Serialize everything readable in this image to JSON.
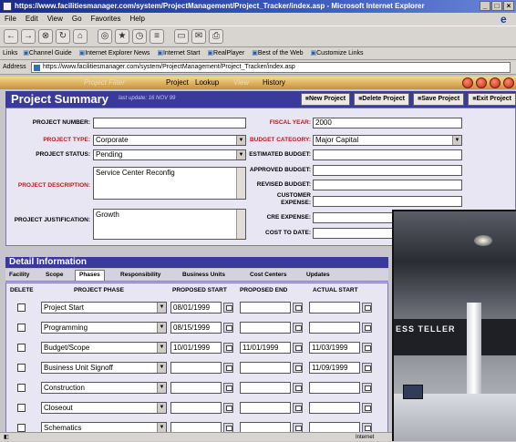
{
  "window": {
    "title": "https://www.facilitiesmanager.com/system/ProjectManagement/Project_Tracker/index.asp - Microsoft Internet Explorer"
  },
  "menubar": [
    "File",
    "Edit",
    "View",
    "Go",
    "Favorites",
    "Help"
  ],
  "toolbar_icons": [
    "back-icon",
    "forward-icon",
    "stop-icon",
    "refresh-icon",
    "home-icon",
    "search-icon",
    "favorites-icon",
    "history-icon",
    "channels-icon",
    "fullscreen-icon",
    "mail-icon",
    "print-icon"
  ],
  "links": {
    "label": "Links",
    "items": [
      "Channel Guide",
      "Internet Explorer News",
      "Internet Start",
      "RealPlayer",
      "Best of the Web",
      "Customize Links"
    ]
  },
  "address": {
    "label": "Address",
    "url": "https://www.facilitiesmanager.com/system/ProjectManagement/Project_Tracker/index.asp"
  },
  "appnav": {
    "filter": "Project Filter",
    "items": [
      "Project",
      "Lookup",
      "View",
      "History"
    ]
  },
  "summary": {
    "title": "Project Summary",
    "last_update": "last update: 16 NOV 99",
    "buttons": [
      "New Project",
      "Delete Project",
      "Save Project",
      "Exit Project"
    ]
  },
  "form": {
    "project_number": {
      "label": "PROJECT NUMBER:",
      "value": ""
    },
    "project_type": {
      "label": "PROJECT TYPE:",
      "value": "Corporate"
    },
    "project_status": {
      "label": "PROJECT STATUS:",
      "value": "Pending"
    },
    "project_description": {
      "label": "PROJECT DESCRIPTION:",
      "value": "Service Center Reconfig"
    },
    "project_justification": {
      "label": "PROJECT JUSTIFICATION:",
      "value": "Growth"
    },
    "fiscal_year": {
      "label": "FISCAL YEAR:",
      "value": "2000"
    },
    "budget_category": {
      "label": "BUDGET CATEGORY:",
      "value": "Major Capital"
    },
    "estimated_budget": {
      "label": "ESTIMATED BUDGET:",
      "value": ""
    },
    "approved_budget": {
      "label": "APPROVED BUDGET:",
      "value": ""
    },
    "revised_budget": {
      "label": "REVISED BUDGET:",
      "value": ""
    },
    "customer_expense": {
      "label": "CUSTOMER EXPENSE:",
      "value": ""
    },
    "cre_expense": {
      "label": "CRE EXPENSE:",
      "value": ""
    },
    "cost_to_date": {
      "label": "COST TO DATE:",
      "value": ""
    }
  },
  "detail": {
    "title": "Detail Information",
    "tabs": [
      "Facility",
      "Scope",
      "Phases",
      "Responsibility",
      "Business Units",
      "Cost Centers",
      "Updates"
    ],
    "active_tab": "Phases",
    "columns": [
      "DELETE",
      "PROJECT PHASE",
      "PROPOSED START",
      "PROPOSED END",
      "ACTUAL START"
    ],
    "rows": [
      {
        "phase": "Project Start",
        "proposed_start": "08/01/1999",
        "proposed_end": "",
        "actual_start": ""
      },
      {
        "phase": "Programming",
        "proposed_start": "08/15/1999",
        "proposed_end": "",
        "actual_start": ""
      },
      {
        "phase": "Budget/Scope",
        "proposed_start": "10/01/1999",
        "proposed_end": "11/01/1999",
        "actual_start": "11/03/1999"
      },
      {
        "phase": "Business Unit Signoff",
        "proposed_start": "",
        "proposed_end": "",
        "actual_start": "11/09/1999"
      },
      {
        "phase": "Construction",
        "proposed_start": "",
        "proposed_end": "",
        "actual_start": ""
      },
      {
        "phase": "Closeout",
        "proposed_start": "",
        "proposed_end": "",
        "actual_start": ""
      },
      {
        "phase": "Schematics",
        "proposed_start": "",
        "proposed_end": "",
        "actual_start": ""
      }
    ]
  },
  "photo": {
    "sign_text": "ESS TELLER"
  },
  "status": {
    "zone": "Internet"
  },
  "colors": {
    "accent": "#3a3a9c",
    "nav": "#c98f3c",
    "required_label": "#c01818"
  }
}
